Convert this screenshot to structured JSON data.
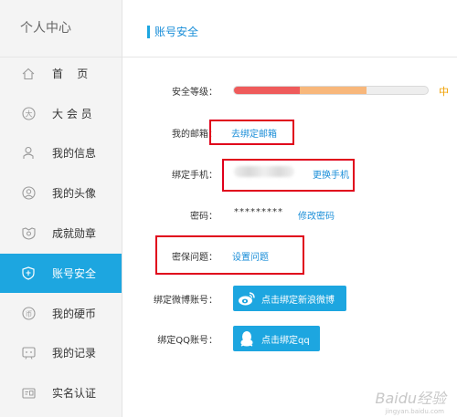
{
  "sidebar": {
    "title": "个人中心",
    "items": [
      {
        "label": "首    页",
        "icon": "home-icon"
      },
      {
        "label": "大 会 员",
        "icon": "vip-icon"
      },
      {
        "label": "我的信息",
        "icon": "user-info-icon"
      },
      {
        "label": "我的头像",
        "icon": "avatar-icon"
      },
      {
        "label": "成就勋章",
        "icon": "medal-icon"
      },
      {
        "label": "账号安全",
        "icon": "shield-icon",
        "active": true
      },
      {
        "label": "我的硬币",
        "icon": "coin-icon"
      },
      {
        "label": "我的记录",
        "icon": "record-icon"
      },
      {
        "label": "实名认证",
        "icon": "id-card-icon"
      }
    ]
  },
  "main": {
    "title": "账号安全",
    "security_level": {
      "label": "安全等级：",
      "value": "中",
      "fill": 0.68
    },
    "email": {
      "label": "我的邮箱：",
      "link": "去绑定邮箱"
    },
    "phone": {
      "label": "绑定手机：",
      "link": "更换手机"
    },
    "password": {
      "label": "密码：",
      "value": "*********",
      "link": "修改密码"
    },
    "security_question": {
      "label": "密保问题：",
      "link": "设置问题"
    },
    "weibo": {
      "label": "绑定微博账号：",
      "button": "点击绑定新浪微博"
    },
    "qq": {
      "label": "绑定QQ账号：",
      "button": "点击绑定qq"
    }
  },
  "colors": {
    "accent": "#1da6e0",
    "link": "#1a8ed8",
    "highlight_box": "#e0001b",
    "level_red": "#ef5b5b",
    "level_orange": "#f8b77b",
    "level_text": "#f0a000"
  },
  "watermark": {
    "brand": "Baidu经验",
    "url": "jingyan.baidu.com"
  }
}
